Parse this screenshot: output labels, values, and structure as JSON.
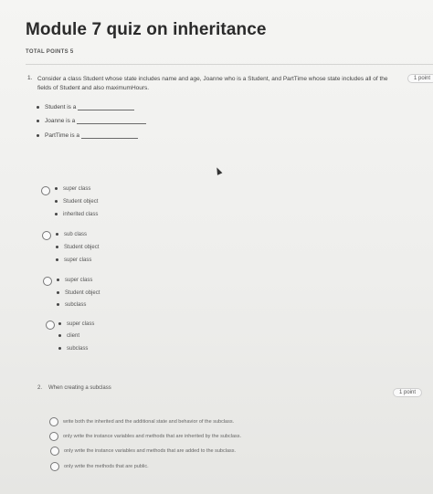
{
  "header": {
    "title": "Module 7 quiz on inheritance",
    "total_points": "TOTAL POINTS 5"
  },
  "question1": {
    "number": "1.",
    "text": "Consider a class Student whose state includes name and age, Joanne who is a Student, and PartTime whose state includes all of the fields of Student and also maximumHours.",
    "points": "1 point",
    "blanks": [
      "Student is a",
      "Joanne is a",
      "PartTime is a"
    ],
    "options": [
      {
        "lines": [
          "super class",
          "Student object",
          "inherited class"
        ],
        "selected": false
      },
      {
        "lines": [
          "sub class",
          "Student object",
          "super class"
        ],
        "selected": false
      },
      {
        "lines": [
          "super class",
          "Student object",
          "subclass"
        ],
        "selected": false
      },
      {
        "lines": [
          "super class",
          "client",
          "subclass"
        ],
        "selected": false
      }
    ]
  },
  "question2": {
    "number": "2.",
    "text": "When creating a subclass",
    "points": "1 point",
    "options": [
      "write both the inherited and the additional state and behavior of the subclass.",
      "only write the instance variables and methods that are inherited by the subclass.",
      "only write the instance variables and methods that are added to the subclass.",
      "only write the methods that are public."
    ]
  }
}
